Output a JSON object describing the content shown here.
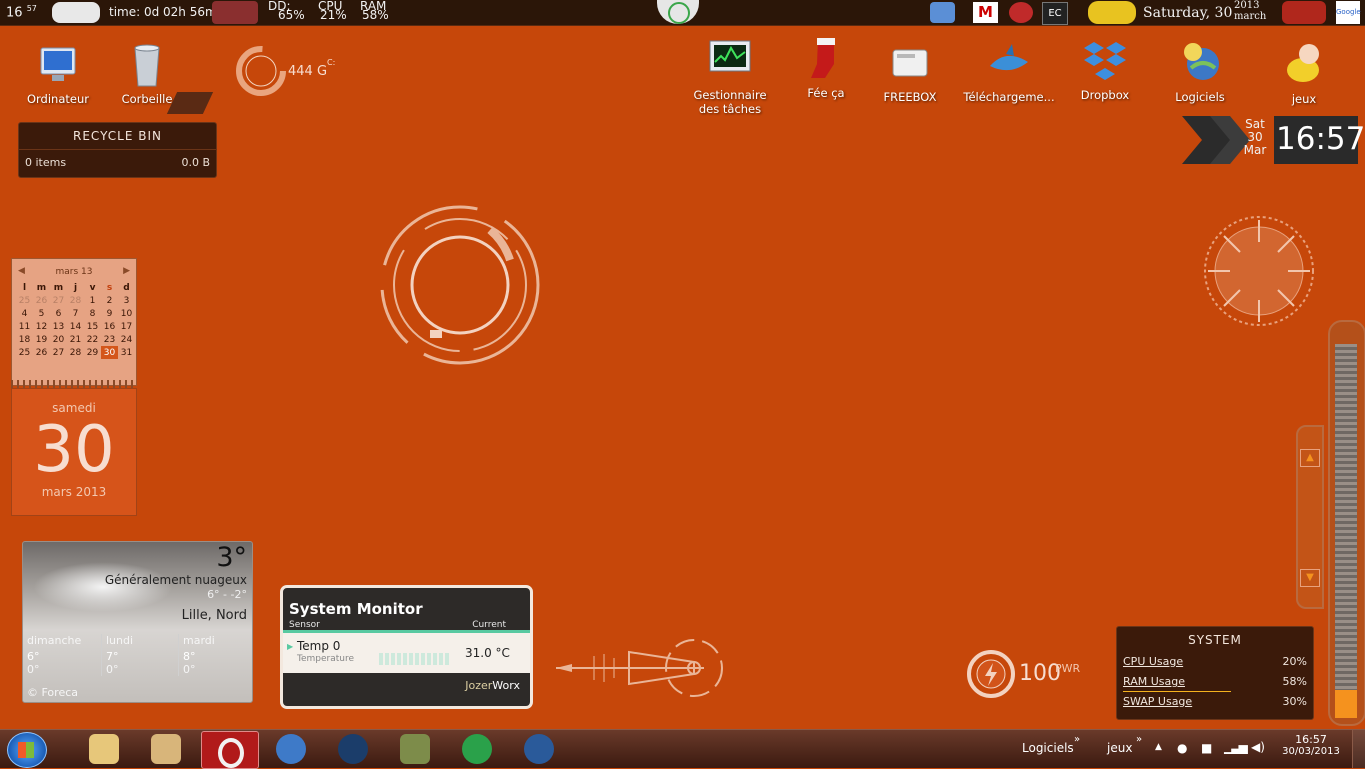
{
  "topbar": {
    "clock_h": "16",
    "clock_m": "57",
    "uptime": "time: 0d 02h 56m",
    "stats": [
      {
        "label": "DD:",
        "value": "65%"
      },
      {
        "label": "CPU",
        "value": "21%"
      },
      {
        "label": "RAM",
        "value": "58%"
      }
    ],
    "date": "Saturday, 30",
    "year": "2013",
    "month": "march"
  },
  "desktop_icons_left": [
    {
      "label": "Ordinateur",
      "icon": "computer-icon"
    },
    {
      "label": "Corbeille",
      "icon": "recycle-bin-icon"
    }
  ],
  "desktop_icons_right": [
    {
      "label": "Gestionnaire des tâches",
      "icon": "task-manager-icon"
    },
    {
      "label": "Fée ça",
      "icon": "stocking-icon"
    },
    {
      "label": "FREEBOX",
      "icon": "freebox-icon"
    },
    {
      "label": "Téléchargeme...",
      "icon": "shark-icon"
    },
    {
      "label": "Dropbox",
      "icon": "dropbox-icon"
    },
    {
      "label": "Logiciels",
      "icon": "folder-globe-icon"
    },
    {
      "label": "jeux",
      "icon": "cartoon-icon"
    }
  ],
  "drive_meter": {
    "value": "444",
    "unit": "G",
    "sub": "C:"
  },
  "recycle_bin": {
    "title": "RECYCLE BIN",
    "items": "0 items",
    "size": "0.0 B"
  },
  "calendar": {
    "month_label": "mars 13",
    "weekdays": [
      "l",
      "m",
      "m",
      "j",
      "v",
      "s",
      "d"
    ],
    "weeks": [
      [
        "25",
        "26",
        "27",
        "28",
        "1",
        "2",
        "3"
      ],
      [
        "4",
        "5",
        "6",
        "7",
        "8",
        "9",
        "10"
      ],
      [
        "11",
        "12",
        "13",
        "14",
        "15",
        "16",
        "17"
      ],
      [
        "18",
        "19",
        "20",
        "21",
        "22",
        "23",
        "24"
      ],
      [
        "25",
        "26",
        "27",
        "28",
        "29",
        "30",
        "31"
      ]
    ],
    "today": "30",
    "day_name": "samedi",
    "day_number": "30",
    "month_year": "mars 2013"
  },
  "weather": {
    "temp": "3°",
    "condition": "Généralement nuageux",
    "range": "6° - -2°",
    "location": "Lille, Nord",
    "forecast": [
      {
        "day": "dimanche",
        "high": "6°",
        "low": "0°"
      },
      {
        "day": "lundi",
        "high": "7°",
        "low": "0°"
      },
      {
        "day": "mardi",
        "high": "8°",
        "low": "0°"
      }
    ],
    "credit": "© Foreca"
  },
  "system_monitor": {
    "title": "System Monitor",
    "col_sensor": "Sensor",
    "col_current": "Current",
    "sensor_name": "Temp 0",
    "sensor_type": "Temperature",
    "sensor_value": "31.0 °C",
    "brand_a": "Jozer",
    "brand_b": "Worx"
  },
  "power": {
    "value": "100",
    "unit": "PWR"
  },
  "clock_gadget": {
    "day": "Sat",
    "date": "30",
    "month": "Mar",
    "time": "16:57"
  },
  "system_gadget": {
    "title": "SYSTEM",
    "rows": [
      {
        "label": "CPU Usage",
        "value": "20%"
      },
      {
        "label": "RAM Usage",
        "value": "58%"
      },
      {
        "label": "SWAP Usage",
        "value": "30%"
      }
    ]
  },
  "taskbar": {
    "toolbars": [
      "Logiciels",
      "jeux"
    ],
    "time": "16:57",
    "date": "30/03/2013"
  },
  "colors": {
    "desktop": "#c6470a",
    "accent": "#f5921e",
    "panel": "#3b1a0a"
  }
}
